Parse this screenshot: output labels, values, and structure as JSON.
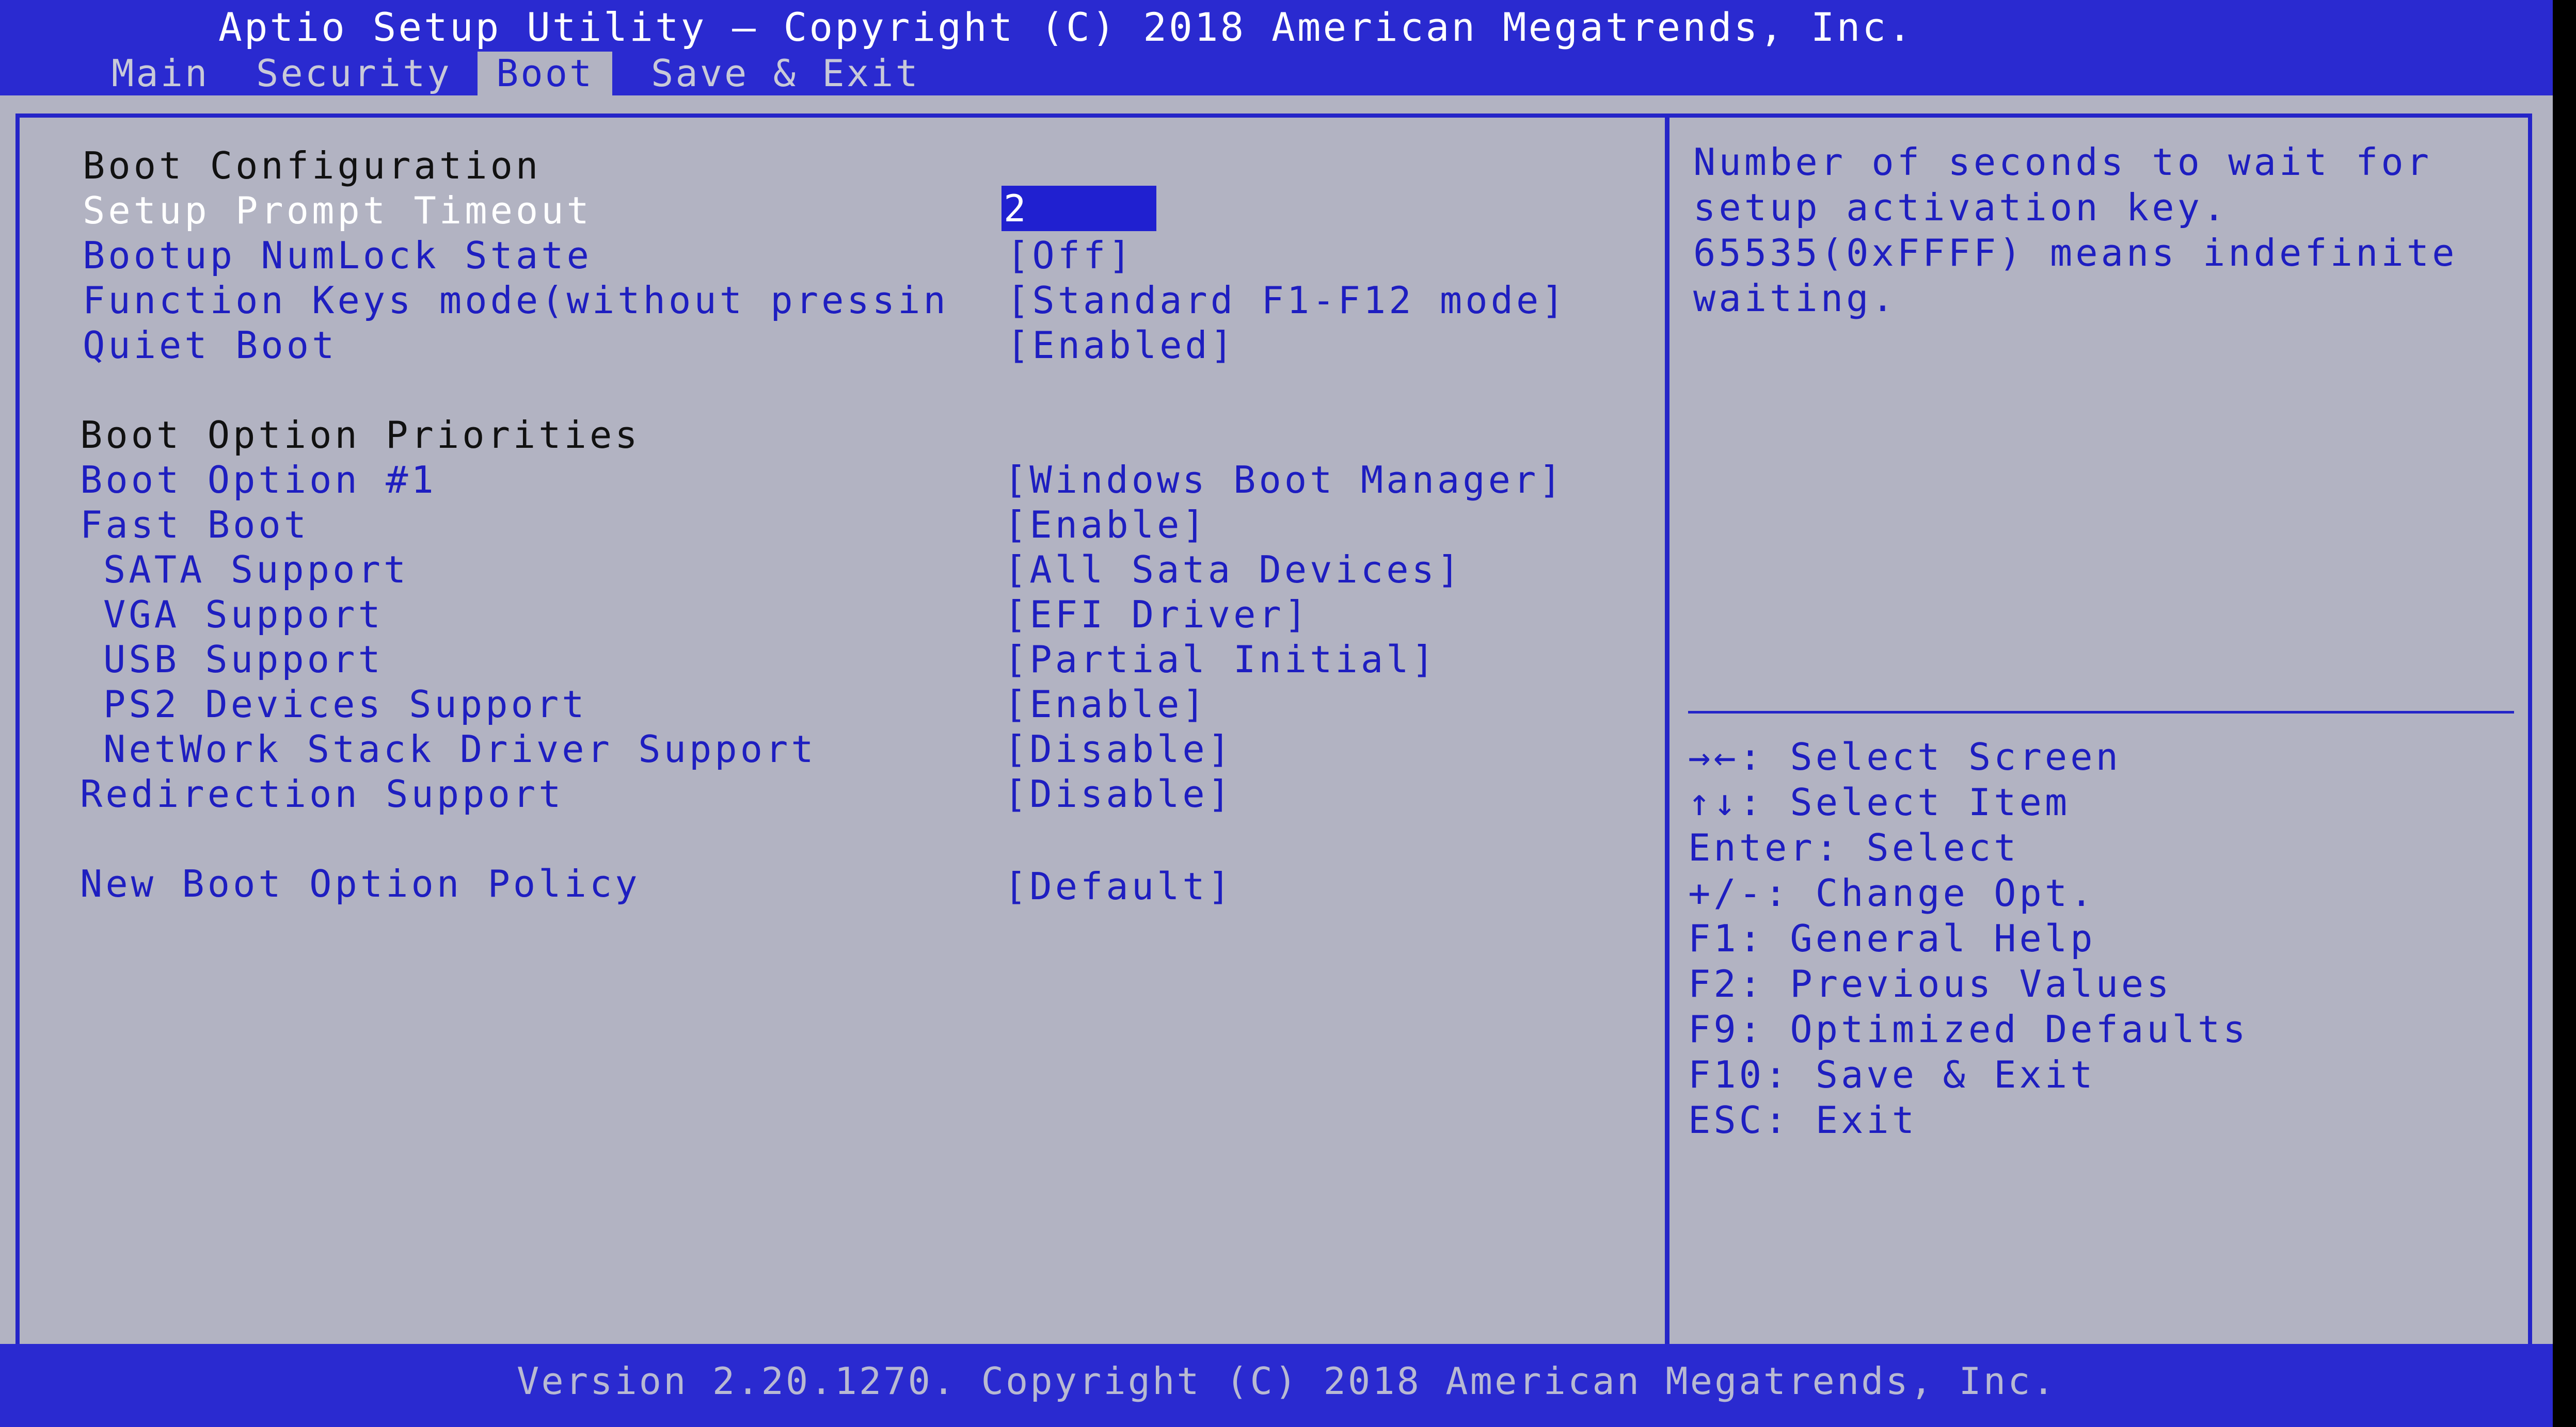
{
  "header": {
    "title": "Aptio Setup Utility – Copyright (C) 2018 American Megatrends, Inc."
  },
  "tabs": [
    {
      "label": "Main",
      "active": false
    },
    {
      "label": "Security",
      "active": false
    },
    {
      "label": "Boot",
      "active": true
    },
    {
      "label": "Save & Exit",
      "active": false
    }
  ],
  "settings": {
    "boot_configuration_header": "Boot Configuration",
    "setup_prompt_timeout": {
      "label": "Setup Prompt Timeout",
      "value": "2"
    },
    "bootup_numlock_state": {
      "label": "Bootup NumLock State",
      "value": "[Off]"
    },
    "function_keys_mode": {
      "label": "Function Keys mode(without pressin",
      "value": "[Standard F1-F12 mode]"
    },
    "quiet_boot": {
      "label": "Quiet Boot",
      "value": "[Enabled]"
    },
    "boot_option_priorities_header": "Boot Option Priorities",
    "boot_option_1": {
      "label": "Boot Option #1",
      "value": "[Windows Boot Manager]"
    },
    "fast_boot": {
      "label": "Fast Boot",
      "value": "[Enable]"
    },
    "sata_support": {
      "label": "SATA Support",
      "value": "[All Sata Devices]"
    },
    "vga_support": {
      "label": "VGA Support",
      "value": "[EFI Driver]"
    },
    "usb_support": {
      "label": "USB Support",
      "value": "[Partial Initial]"
    },
    "ps2_devices_support": {
      "label": "PS2 Devices Support",
      "value": "[Enable]"
    },
    "network_stack_driver_support": {
      "label": "NetWork Stack Driver Support",
      "value": "[Disable]"
    },
    "redirection_support": {
      "label": "Redirection Support",
      "value": "[Disable]"
    },
    "new_boot_option_policy": {
      "label": "New Boot Option Policy",
      "value": "[Default]"
    }
  },
  "help": {
    "description": "Number of seconds to wait for setup activation key. 65535(0xFFFF) means indefinite waiting."
  },
  "keys": [
    "→←: Select Screen",
    "↑↓: Select Item",
    "Enter: Select",
    "+/-: Change Opt.",
    "F1: General Help",
    "F2: Previous Values",
    "F9: Optimized Defaults",
    "F10: Save & Exit",
    "ESC: Exit"
  ],
  "footer": {
    "text": "Version 2.20.1270. Copyright (C) 2018 American Megatrends, Inc."
  },
  "colors": {
    "bar_blue": "#2a2ad0",
    "panel_gray": "#b2b3c2",
    "text_blue": "#1e1ec0",
    "highlight_white": "#ffffff"
  }
}
